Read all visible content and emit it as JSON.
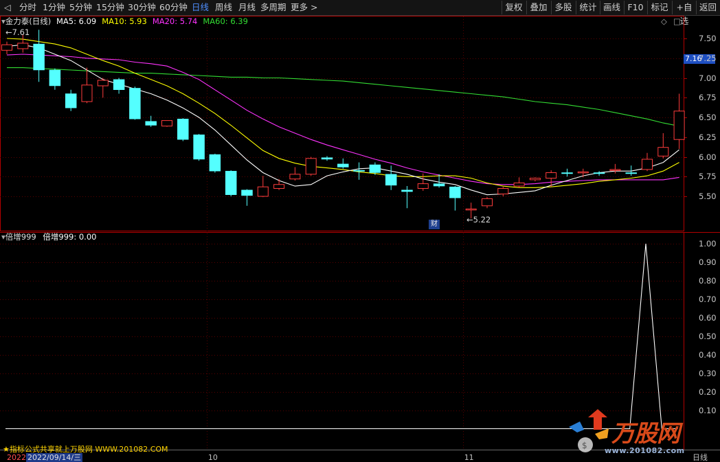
{
  "toolbar": {
    "left_tabs": [
      {
        "label": "分时",
        "active": false
      },
      {
        "label": "1分钟",
        "active": false
      },
      {
        "label": "5分钟",
        "active": false
      },
      {
        "label": "15分钟",
        "active": false
      },
      {
        "label": "30分钟",
        "active": false
      },
      {
        "label": "60分钟",
        "active": false
      },
      {
        "label": "日线",
        "active": true
      },
      {
        "label": "周线",
        "active": false
      },
      {
        "label": "月线",
        "active": false
      },
      {
        "label": "多周期",
        "active": false
      },
      {
        "label": "更多 >",
        "active": false
      }
    ],
    "right_buttons": [
      "复权",
      "叠加",
      "多股",
      "统计",
      "画线",
      "F10",
      "标记",
      "+自选",
      "返回"
    ]
  },
  "main_pane": {
    "title": "金力泰(日线)",
    "ma_legend": [
      {
        "label": "MA5: 6.09",
        "color": "#ffffff"
      },
      {
        "label": "MA10: 5.93",
        "color": "#ffff00"
      },
      {
        "label": "MA20: 5.74",
        "color": "#ff33ff"
      },
      {
        "label": "MA60: 6.39",
        "color": "#33dd33"
      }
    ],
    "high_annotation": "7.61",
    "low_annotation": "5.22",
    "current_price_tag": "7.16",
    "event_badge": "财",
    "icons": [
      "diamond-icon",
      "square-icon"
    ]
  },
  "sub_pane": {
    "title": "倍增999",
    "value_label": "倍增999: 0.00"
  },
  "footer": {
    "promo": "★指标公式共享就上万股网 WWW.201082.COM",
    "year": "2022",
    "cursor_date": "2022/09/14/三",
    "x_labels": [
      {
        "label": "10",
        "index": 13
      },
      {
        "label": "11",
        "index": 29
      }
    ],
    "period": "日线"
  },
  "watermark": {
    "text": "万股网",
    "url": "www.201082.com"
  },
  "colors": {
    "up": "#ff3c3c",
    "down": "#54ffff",
    "ma5": "#ffffff",
    "ma10": "#ffff00",
    "ma20": "#ff33ff",
    "ma60": "#33dd33",
    "grid": "#5a0000",
    "axis": "#b40000"
  },
  "chart_data": [
    {
      "type": "candlestick",
      "ylim": [
        5.22,
        7.61
      ],
      "y_ticks": [
        5.5,
        5.75,
        6.0,
        6.25,
        6.5,
        6.75,
        7.0,
        7.25,
        7.5
      ],
      "candles": [
        [
          7.35,
          7.42,
          7.46,
          7.3
        ],
        [
          7.37,
          7.44,
          7.55,
          7.32
        ],
        [
          7.43,
          7.1,
          7.61,
          6.95
        ],
        [
          7.1,
          6.9,
          7.12,
          6.85
        ],
        [
          6.8,
          6.62,
          6.85,
          6.58
        ],
        [
          6.7,
          6.91,
          7.13,
          6.68
        ],
        [
          6.9,
          6.97,
          7.0,
          6.75
        ],
        [
          6.98,
          6.85,
          7.0,
          6.8
        ],
        [
          6.87,
          6.48,
          6.89,
          6.47
        ],
        [
          6.45,
          6.4,
          6.52,
          6.38
        ],
        [
          6.39,
          6.46,
          6.46,
          6.38
        ],
        [
          6.48,
          6.22,
          6.49,
          6.2
        ],
        [
          6.28,
          5.97,
          6.29,
          5.95
        ],
        [
          6.03,
          5.82,
          6.04,
          5.8
        ],
        [
          5.82,
          5.52,
          5.83,
          5.5
        ],
        [
          5.58,
          5.51,
          5.59,
          5.38
        ],
        [
          5.5,
          5.62,
          5.76,
          5.49
        ],
        [
          5.6,
          5.65,
          5.72,
          5.58
        ],
        [
          5.72,
          5.78,
          5.87,
          5.7
        ],
        [
          5.78,
          5.98,
          6.0,
          5.76
        ],
        [
          5.99,
          5.97,
          6.01,
          5.95
        ],
        [
          5.91,
          5.87,
          5.98,
          5.85
        ],
        [
          5.83,
          5.82,
          5.93,
          5.71
        ],
        [
          5.9,
          5.8,
          5.93,
          5.77
        ],
        [
          5.78,
          5.64,
          5.89,
          5.58
        ],
        [
          5.58,
          5.56,
          5.63,
          5.35
        ],
        [
          5.6,
          5.66,
          5.79,
          5.57
        ],
        [
          5.66,
          5.63,
          5.78,
          5.61
        ],
        [
          5.62,
          5.48,
          5.63,
          5.32
        ],
        [
          5.33,
          5.34,
          5.42,
          5.22
        ],
        [
          5.38,
          5.47,
          5.49,
          5.35
        ],
        [
          5.53,
          5.6,
          5.62,
          5.5
        ],
        [
          5.63,
          5.67,
          5.74,
          5.61
        ],
        [
          5.71,
          5.73,
          5.74,
          5.69
        ],
        [
          5.73,
          5.8,
          5.83,
          5.62
        ],
        [
          5.8,
          5.79,
          5.85,
          5.75
        ],
        [
          5.81,
          5.81,
          5.85,
          5.74
        ],
        [
          5.8,
          5.79,
          5.82,
          5.76
        ],
        [
          5.83,
          5.84,
          5.91,
          5.79
        ],
        [
          5.8,
          5.79,
          5.89,
          5.76
        ],
        [
          5.84,
          5.97,
          6.05,
          5.82
        ],
        [
          6.01,
          6.12,
          6.3,
          5.98
        ],
        [
          6.22,
          6.58,
          6.8,
          6.1
        ]
      ],
      "ma5": [
        7.4,
        7.42,
        7.38,
        7.3,
        7.22,
        7.1,
        6.98,
        6.92,
        6.86,
        6.8,
        6.72,
        6.62,
        6.5,
        6.34,
        6.15,
        5.96,
        5.8,
        5.7,
        5.63,
        5.65,
        5.76,
        5.81,
        5.85,
        5.86,
        5.82,
        5.78,
        5.72,
        5.68,
        5.65,
        5.58,
        5.52,
        5.53,
        5.55,
        5.57,
        5.64,
        5.7,
        5.76,
        5.8,
        5.82,
        5.82,
        5.86,
        5.93,
        6.09
      ],
      "ma10": [
        7.5,
        7.49,
        7.46,
        7.43,
        7.38,
        7.3,
        7.22,
        7.15,
        7.06,
        6.98,
        6.9,
        6.8,
        6.68,
        6.55,
        6.4,
        6.24,
        6.08,
        5.98,
        5.92,
        5.88,
        5.86,
        5.84,
        5.81,
        5.79,
        5.76,
        5.75,
        5.75,
        5.76,
        5.76,
        5.73,
        5.67,
        5.63,
        5.61,
        5.61,
        5.62,
        5.64,
        5.66,
        5.69,
        5.71,
        5.73,
        5.76,
        5.82,
        5.93
      ],
      "ma20": [
        7.29,
        7.3,
        7.29,
        7.28,
        7.27,
        7.25,
        7.24,
        7.23,
        7.2,
        7.18,
        7.15,
        7.07,
        6.98,
        6.85,
        6.72,
        6.59,
        6.48,
        6.38,
        6.3,
        6.22,
        6.15,
        6.09,
        6.03,
        5.97,
        5.92,
        5.86,
        5.81,
        5.77,
        5.73,
        5.69,
        5.66,
        5.65,
        5.65,
        5.66,
        5.68,
        5.69,
        5.7,
        5.71,
        5.71,
        5.71,
        5.71,
        5.71,
        5.74
      ],
      "ma60": [
        7.13,
        7.13,
        7.12,
        7.11,
        7.1,
        7.09,
        7.08,
        7.07,
        7.06,
        7.06,
        7.05,
        7.04,
        7.03,
        7.02,
        7.01,
        7.01,
        7.0,
        7.0,
        6.99,
        6.98,
        6.97,
        6.96,
        6.94,
        6.92,
        6.9,
        6.88,
        6.86,
        6.84,
        6.82,
        6.8,
        6.78,
        6.76,
        6.73,
        6.7,
        6.68,
        6.66,
        6.63,
        6.6,
        6.56,
        6.52,
        6.48,
        6.43,
        6.39
      ]
    },
    {
      "type": "line",
      "title": "倍增999",
      "ylim": [
        0,
        1.0
      ],
      "y_ticks": [
        0.1,
        0.2,
        0.3,
        0.4,
        0.5,
        0.6,
        0.7,
        0.8,
        0.9,
        1.0
      ],
      "values": [
        0,
        0,
        0,
        0,
        0,
        0,
        0,
        0,
        0,
        0,
        0,
        0,
        0,
        0,
        0,
        0,
        0,
        0,
        0,
        0,
        0,
        0,
        0,
        0,
        0,
        0,
        0,
        0,
        0,
        0,
        0,
        0,
        0,
        0,
        0,
        0,
        0,
        0,
        0,
        0,
        1.0,
        0,
        0
      ]
    }
  ]
}
